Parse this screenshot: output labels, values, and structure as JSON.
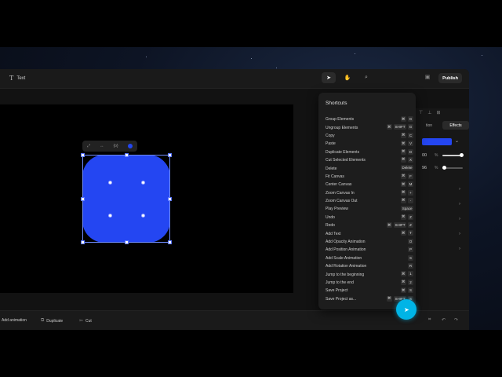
{
  "toolbar": {
    "text_tool_label": "Text",
    "text_tool_icon": "text-icon",
    "select_tool_icon": "pointer-icon",
    "hand_tool_icon": "hand-icon",
    "search_tool_icon": "search-icon",
    "save_icon": "save-icon",
    "publish_label": "Publish"
  },
  "floating_toolbar": {
    "expand_icon": "expand-icon",
    "move_icon": "move-icon",
    "code_label": "{o}",
    "color_icon": "color-dot-icon"
  },
  "right_panel": {
    "tabs": [
      "tion",
      "Effects"
    ],
    "fill_color": "#2446f2",
    "value_1": "00",
    "unit_1": "%",
    "value_1_fraction": 1.0,
    "value_2": "96",
    "unit_2": "%",
    "value_2_fraction": 0.0
  },
  "shortcuts": {
    "title": "Shortcuts",
    "items": [
      {
        "label": "Group Elements",
        "keys": [
          "⌘",
          "G"
        ]
      },
      {
        "label": "Ungroup Elements",
        "keys": [
          "⌘",
          "SHIFT",
          "G"
        ]
      },
      {
        "label": "Copy",
        "keys": [
          "⌘",
          "C"
        ]
      },
      {
        "label": "Paste",
        "keys": [
          "⌘",
          "V"
        ]
      },
      {
        "label": "Duplicate Elements",
        "keys": [
          "⌘",
          "D"
        ]
      },
      {
        "label": "Cut Selected Elements",
        "keys": [
          "⌘",
          "X"
        ]
      },
      {
        "label": "Delete",
        "keys": [
          "Delete"
        ]
      },
      {
        "label": "Fit Canvas",
        "keys": [
          "⌘",
          "F"
        ]
      },
      {
        "label": "Center Canvas",
        "keys": [
          "⌘",
          "M"
        ]
      },
      {
        "label": "Zoom Canvas In",
        "keys": [
          "⌘",
          "+"
        ]
      },
      {
        "label": "Zoom Canvas Out",
        "keys": [
          "⌘",
          "-"
        ]
      },
      {
        "label": "Play Preview",
        "keys": [
          "Space"
        ]
      },
      {
        "label": "Undo",
        "keys": [
          "⌘",
          "Z"
        ]
      },
      {
        "label": "Redo",
        "keys": [
          "⌘",
          "SHIFT",
          "Z"
        ]
      },
      {
        "label": "Add Text",
        "keys": [
          "⌘",
          "T"
        ]
      },
      {
        "label": "Add Opacity Animation",
        "keys": [
          "O"
        ]
      },
      {
        "label": "Add Position Animation",
        "keys": [
          "P"
        ]
      },
      {
        "label": "Add Scale Animation",
        "keys": [
          "S"
        ]
      },
      {
        "label": "Add Rotation Animation",
        "keys": [
          "R"
        ]
      },
      {
        "label": "Jump to the beginning",
        "keys": [
          "⌘",
          "1"
        ]
      },
      {
        "label": "Jump to the end",
        "keys": [
          "⌘",
          "2"
        ]
      },
      {
        "label": "Save Project",
        "keys": [
          "⌘",
          "S"
        ]
      },
      {
        "label": "Save Project as...",
        "keys": [
          "⌘",
          "SHIFT",
          "S"
        ]
      }
    ]
  },
  "bottombar": {
    "add_animation_label": "Add animation",
    "duplicate_label": "Duplicate",
    "duplicate_icon": "duplicate-icon",
    "cut_label": "Cut",
    "cut_icon": "scissors-icon",
    "grid_icon": "grid-icon",
    "undo_icon": "undo-icon",
    "redo_icon": "redo-icon"
  },
  "colors": {
    "shape_fill": "#2446f2",
    "cursor_highlight": "#00b4e6"
  }
}
